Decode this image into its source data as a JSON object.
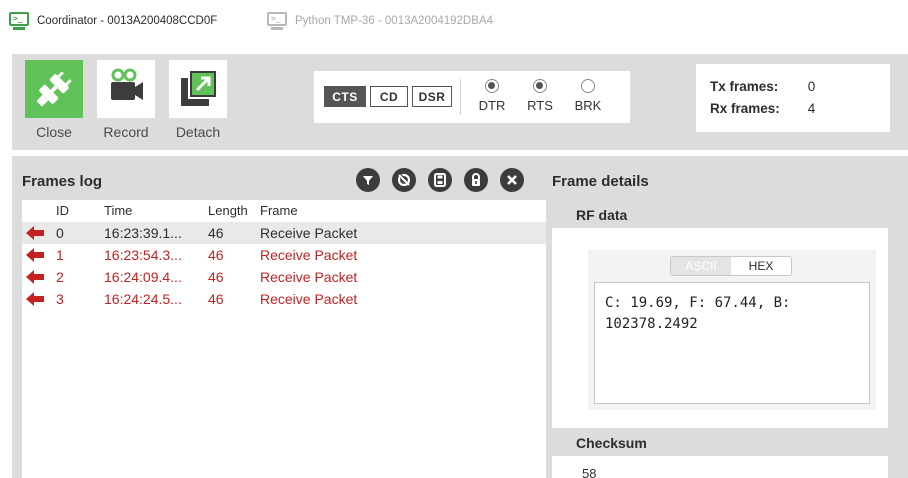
{
  "tabs": [
    {
      "label": "Coordinator - 0013A200408CCD0F",
      "icon": "terminal-monitor-icon",
      "active": true
    },
    {
      "label": "Python TMP-36 - 0013A2004192DBA4",
      "icon": "terminal-monitor-icon",
      "active": false
    }
  ],
  "toolbar": {
    "close_label": "Close",
    "record_label": "Record",
    "detach_label": "Detach",
    "lines": {
      "cts": "CTS",
      "cd": "CD",
      "dsr": "DSR"
    },
    "radios": [
      {
        "label": "DTR",
        "selected": true
      },
      {
        "label": "RTS",
        "selected": true
      },
      {
        "label": "BRK",
        "selected": false
      }
    ],
    "counts": {
      "tx_label": "Tx frames:",
      "tx_value": "0",
      "rx_label": "Rx frames:",
      "rx_value": "4"
    }
  },
  "frames_log": {
    "title": "Frames log",
    "actions": [
      "filter-icon",
      "reset-icon",
      "save-icon",
      "lock-icon",
      "clear-icon"
    ],
    "columns": {
      "id": "ID",
      "time": "Time",
      "length": "Length",
      "frame": "Frame"
    },
    "rows": [
      {
        "id": "0",
        "time": "16:23:39.1...",
        "length": "46",
        "frame": "Receive Packet",
        "selected": true
      },
      {
        "id": "1",
        "time": "16:23:54.3...",
        "length": "46",
        "frame": "Receive Packet",
        "selected": false
      },
      {
        "id": "2",
        "time": "16:24:09.4...",
        "length": "46",
        "frame": "Receive Packet",
        "selected": false
      },
      {
        "id": "3",
        "time": "16:24:24.5...",
        "length": "46",
        "frame": "Receive Packet",
        "selected": false
      }
    ]
  },
  "frame_details": {
    "title": "Frame details",
    "rf_data_label": "RF data",
    "mode_ascii": "ASCII",
    "mode_hex": "HEX",
    "rf_data_text": "C: 19.69, F: 67.44, B: 102378.2492",
    "checksum_label": "Checksum",
    "checksum_value": "58"
  },
  "colors": {
    "accent_green": "#62c25a",
    "received_red": "#c42121",
    "panel_gray": "#dcdcdc"
  }
}
